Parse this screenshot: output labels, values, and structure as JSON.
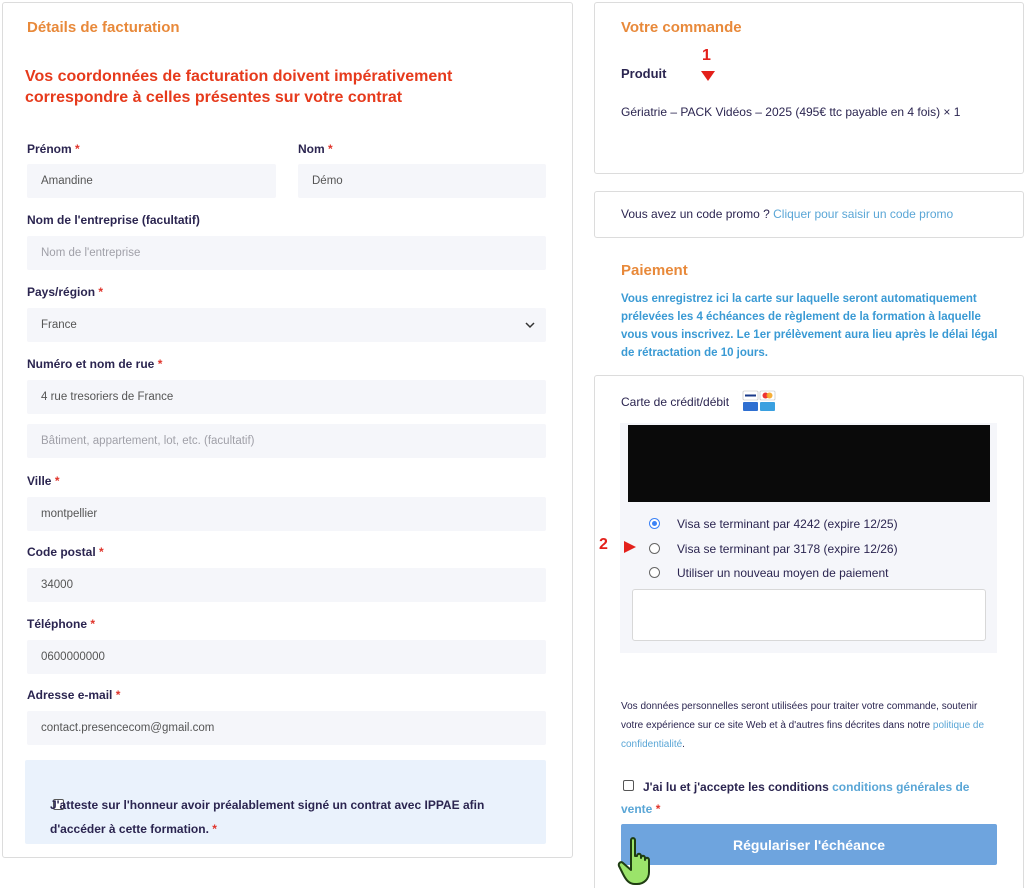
{
  "billing": {
    "title": "Détails de facturation",
    "warning": "Vos coordonnées de facturation doivent impérativement correspondre à celles présentes sur votre contrat",
    "required_mark": "*",
    "first_name": {
      "label": "Prénom",
      "value": "Amandine"
    },
    "last_name": {
      "label": "Nom",
      "value": "Démo"
    },
    "company": {
      "label": "Nom de l'entreprise (facultatif)",
      "placeholder": "Nom de l'entreprise"
    },
    "country": {
      "label": "Pays/région",
      "value": "France"
    },
    "street": {
      "label": "Numéro et nom de rue",
      "value": "4 rue tresoriers de France",
      "placeholder2": "Bâtiment, appartement, lot, etc. (facultatif)"
    },
    "city": {
      "label": "Ville",
      "value": "montpellier"
    },
    "postcode": {
      "label": "Code postal",
      "value": "34000"
    },
    "phone": {
      "label": "Téléphone",
      "value": "0600000000"
    },
    "email": {
      "label": "Adresse e-mail",
      "value": "contact.presencecom@gmail.com"
    },
    "attest": "J'atteste sur l'honneur avoir préalablement signé un contrat avec IPPAE afin d'accéder à cette formation."
  },
  "order": {
    "title": "Votre commande",
    "product_header": "Produit",
    "product_line": "Gériatrie – PACK Vidéos – 2025 (495€ ttc payable en 4 fois) × 1"
  },
  "promo": {
    "question": "Vous avez un code promo ?",
    "link": "Cliquer pour saisir un code promo"
  },
  "payment": {
    "title": "Paiement",
    "description": "Vous enregistrez ici la carte sur laquelle seront automatiquement prélevées les 4 échéances de règlement de la formation à laquelle vous vous inscrivez. Le 1er prélèvement aura lieu après le délai légal de rétractation de 10 jours.",
    "method_label": "Carte de crédit/débit",
    "options": [
      {
        "label": "Visa se terminant par 4242 (expire 12/25)",
        "selected": true
      },
      {
        "label": "Visa se terminant par 3178 (expire 12/26)",
        "selected": false
      },
      {
        "label": "Utiliser un nouveau moyen de paiement",
        "selected": false
      }
    ],
    "privacy_text": "Vos données personnelles seront utilisées pour traiter votre commande, soutenir votre expérience sur ce site Web et à d'autres fins décrites dans notre",
    "privacy_link": "politique de confidentialité",
    "privacy_end": ".",
    "terms_text": "J'ai lu et j'accepte les conditions",
    "terms_link": "conditions générales de vente",
    "submit": "Régulariser l'échéance"
  },
  "annotations": {
    "one": "1",
    "two": "2"
  },
  "colors": {
    "accent_orange": "#e8893a",
    "warning_red": "#e63a1c",
    "link_blue": "#5aa6d6",
    "button_blue": "#6ea4de"
  }
}
